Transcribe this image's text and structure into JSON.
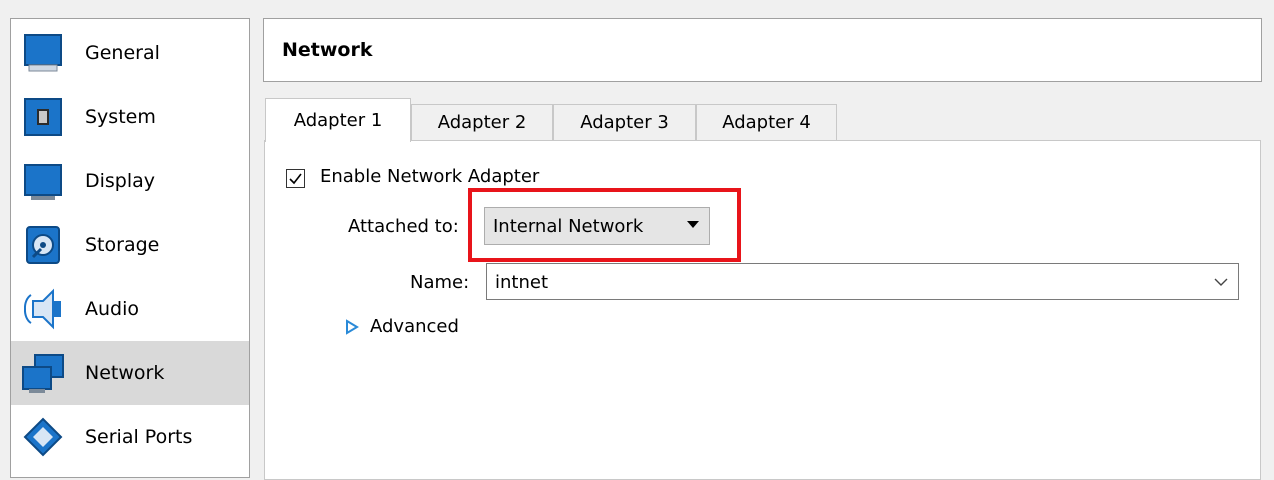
{
  "sidebar": {
    "items": [
      {
        "label": "General",
        "icon": "general-icon"
      },
      {
        "label": "System",
        "icon": "system-icon"
      },
      {
        "label": "Display",
        "icon": "display-icon"
      },
      {
        "label": "Storage",
        "icon": "storage-icon"
      },
      {
        "label": "Audio",
        "icon": "audio-icon"
      },
      {
        "label": "Network",
        "icon": "network-icon",
        "selected": true
      },
      {
        "label": "Serial Ports",
        "icon": "serial-ports-icon"
      }
    ]
  },
  "header": {
    "title": "Network"
  },
  "tabs": [
    {
      "label": "Adapter 1",
      "active": true
    },
    {
      "label": "Adapter 2"
    },
    {
      "label": "Adapter 3"
    },
    {
      "label": "Adapter 4"
    }
  ],
  "adapter": {
    "enable_label": "Enable Network Adapter",
    "enabled": true,
    "attached_label": "Attached to:",
    "attached_value": "Internal Network",
    "name_label": "Name:",
    "name_value": "intnet",
    "advanced_label": "Advanced"
  },
  "colors": {
    "highlight": "#e8141a",
    "icon_blue": "#1b74c9",
    "advanced_arrow": "#2a8ad8"
  }
}
